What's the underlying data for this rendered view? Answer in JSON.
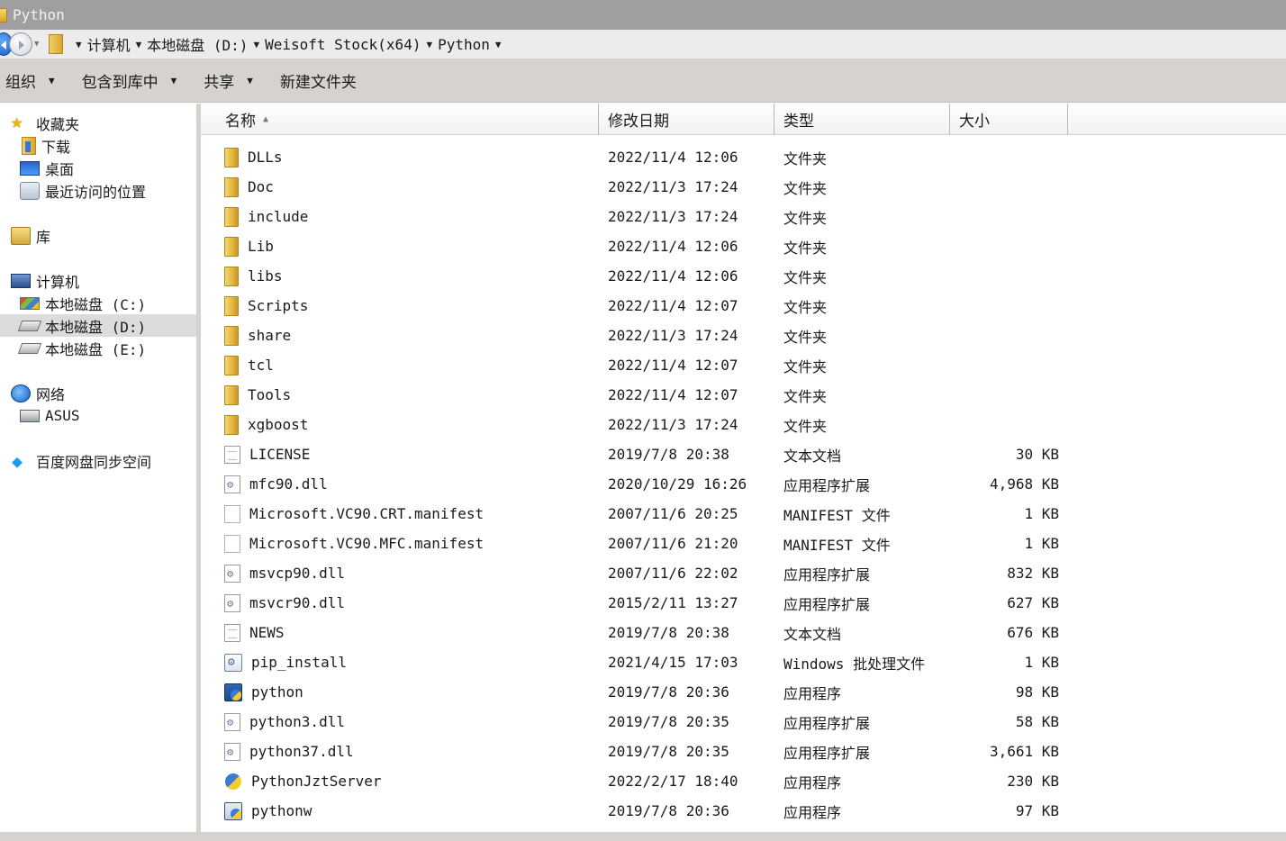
{
  "window": {
    "title": "Python"
  },
  "address": {
    "crumbs": [
      "计算机",
      "本地磁盘 (D:)",
      "Weisoft Stock(x64)",
      "Python"
    ]
  },
  "toolbar": {
    "organize": "组织",
    "include_in_library": "包含到库中",
    "share": "共享",
    "new_folder": "新建文件夹"
  },
  "nav": {
    "favorites": "收藏夹",
    "downloads": "下载",
    "desktop": "桌面",
    "recent": "最近访问的位置",
    "libraries": "库",
    "computer": "计算机",
    "drive_c": "本地磁盘 (C:)",
    "drive_d": "本地磁盘 (D:)",
    "drive_e": "本地磁盘 (E:)",
    "network": "网络",
    "network_device": "ASUS",
    "baidu": "百度网盘同步空间"
  },
  "columns": {
    "name": "名称",
    "modified": "修改日期",
    "type": "类型",
    "size": "大小"
  },
  "files": [
    {
      "name": "DLLs",
      "modified": "2022/11/4 12:06",
      "type": "文件夹",
      "size": "",
      "icon": "folder-icon"
    },
    {
      "name": "Doc",
      "modified": "2022/11/3 17:24",
      "type": "文件夹",
      "size": "",
      "icon": "folder-icon"
    },
    {
      "name": "include",
      "modified": "2022/11/3 17:24",
      "type": "文件夹",
      "size": "",
      "icon": "folder-icon"
    },
    {
      "name": "Lib",
      "modified": "2022/11/4 12:06",
      "type": "文件夹",
      "size": "",
      "icon": "folder-icon"
    },
    {
      "name": "libs",
      "modified": "2022/11/4 12:06",
      "type": "文件夹",
      "size": "",
      "icon": "folder-icon"
    },
    {
      "name": "Scripts",
      "modified": "2022/11/4 12:07",
      "type": "文件夹",
      "size": "",
      "icon": "folder-icon"
    },
    {
      "name": "share",
      "modified": "2022/11/3 17:24",
      "type": "文件夹",
      "size": "",
      "icon": "folder-icon"
    },
    {
      "name": "tcl",
      "modified": "2022/11/4 12:07",
      "type": "文件夹",
      "size": "",
      "icon": "folder-icon"
    },
    {
      "name": "Tools",
      "modified": "2022/11/4 12:07",
      "type": "文件夹",
      "size": "",
      "icon": "folder-icon"
    },
    {
      "name": "xgboost",
      "modified": "2022/11/3 17:24",
      "type": "文件夹",
      "size": "",
      "icon": "folder-icon"
    },
    {
      "name": "LICENSE",
      "modified": "2019/7/8 20:38",
      "type": "文本文档",
      "size": "30 KB",
      "icon": "text-document-icon"
    },
    {
      "name": "mfc90.dll",
      "modified": "2020/10/29 16:26",
      "type": "应用程序扩展",
      "size": "4,968 KB",
      "icon": "dll-icon"
    },
    {
      "name": "Microsoft.VC90.CRT.manifest",
      "modified": "2007/11/6 20:25",
      "type": "MANIFEST 文件",
      "size": "1 KB",
      "icon": "manifest-file-icon"
    },
    {
      "name": "Microsoft.VC90.MFC.manifest",
      "modified": "2007/11/6 21:20",
      "type": "MANIFEST 文件",
      "size": "1 KB",
      "icon": "manifest-file-icon"
    },
    {
      "name": "msvcp90.dll",
      "modified": "2007/11/6 22:02",
      "type": "应用程序扩展",
      "size": "832 KB",
      "icon": "dll-icon"
    },
    {
      "name": "msvcr90.dll",
      "modified": "2015/2/11 13:27",
      "type": "应用程序扩展",
      "size": "627 KB",
      "icon": "dll-icon"
    },
    {
      "name": "NEWS",
      "modified": "2019/7/8 20:38",
      "type": "文本文档",
      "size": "676 KB",
      "icon": "text-document-icon"
    },
    {
      "name": "pip_install",
      "modified": "2021/4/15 17:03",
      "type": "Windows 批处理文件",
      "size": "1 KB",
      "icon": "batch-file-icon"
    },
    {
      "name": "python",
      "modified": "2019/7/8 20:36",
      "type": "应用程序",
      "size": "98 KB",
      "icon": "python-exe-icon"
    },
    {
      "name": "python3.dll",
      "modified": "2019/7/8 20:35",
      "type": "应用程序扩展",
      "size": "58 KB",
      "icon": "dll-icon"
    },
    {
      "name": "python37.dll",
      "modified": "2019/7/8 20:35",
      "type": "应用程序扩展",
      "size": "3,661 KB",
      "icon": "dll-icon"
    },
    {
      "name": "PythonJztServer",
      "modified": "2022/2/17 18:40",
      "type": "应用程序",
      "size": "230 KB",
      "icon": "python-logo-icon"
    },
    {
      "name": "pythonw",
      "modified": "2019/7/8 20:36",
      "type": "应用程序",
      "size": "97 KB",
      "icon": "python-window-exe-icon"
    }
  ]
}
